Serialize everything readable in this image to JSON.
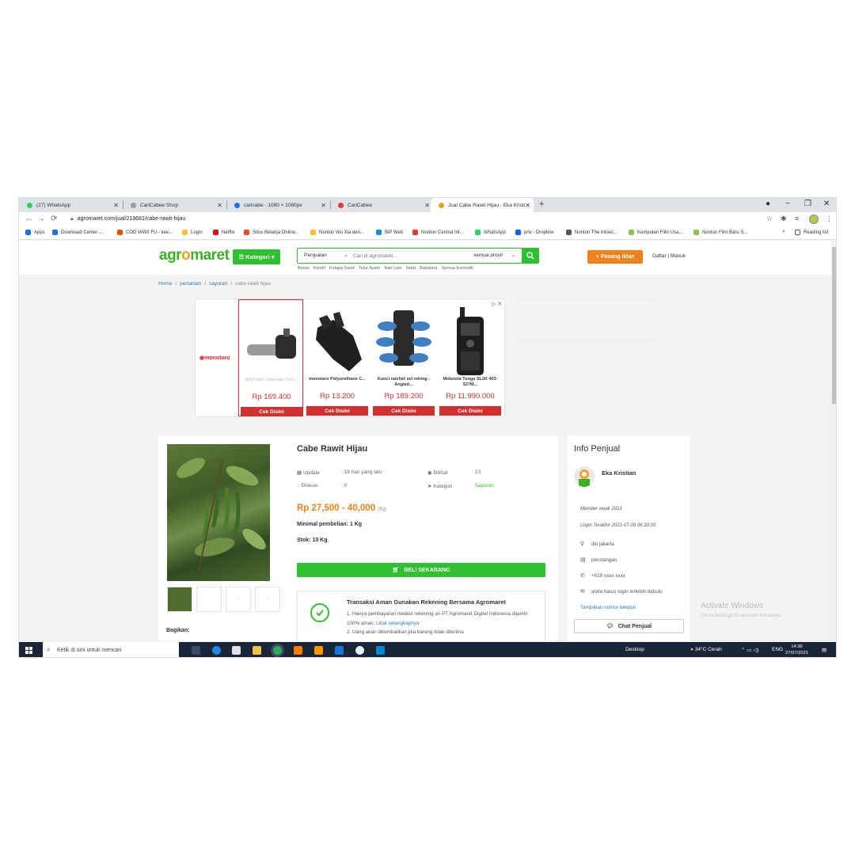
{
  "browser": {
    "tabs": [
      {
        "title": "(27) WhatsApp",
        "color": "#25d366"
      },
      {
        "title": "CariCabee Shop",
        "color": "#9e9e9e"
      },
      {
        "title": "caricabe - 1080 × 1080px",
        "color": "#1a73e8"
      },
      {
        "title": "CariCabee",
        "color": "#e53935"
      },
      {
        "title": "Jual Cabe Rawit Hijau - Eka Kristi",
        "color": "#e8a317"
      }
    ],
    "url": "agromaret.com/jual/219681/cabe-rawit-hijau",
    "bookmarks": [
      {
        "label": "Apps",
        "color": "#1a73e8"
      },
      {
        "label": "Download Center -...",
        "color": "#1a73e8"
      },
      {
        "label": "COD WWII FU - kee...",
        "color": "#e65100"
      },
      {
        "label": "Login",
        "color": "#fbc02d"
      },
      {
        "label": "Netflix",
        "color": "#e50914"
      },
      {
        "label": "Situs Belanja Online...",
        "color": "#ee4d2d"
      },
      {
        "label": "Nonton Wu Xia den...",
        "color": "#fbc02d"
      },
      {
        "label": "BiP Web",
        "color": "#1e88e5"
      },
      {
        "label": "Nonton Central Int...",
        "color": "#e53935"
      },
      {
        "label": "WhatsApp",
        "color": "#25d366"
      },
      {
        "label": "priv - Dropbox",
        "color": "#0061ff"
      },
      {
        "label": "Nonton The Intouc...",
        "color": "#555555"
      },
      {
        "label": "Kumpulan Film Usa...",
        "color": "#8bc34a"
      },
      {
        "label": "Nonton Film Baru S...",
        "color": "#8bc34a"
      }
    ],
    "bookmarks_more": "»",
    "reading_list": "Reading list"
  },
  "site": {
    "logo_left": "agr",
    "logo_o": "o",
    "logo_right": "maret",
    "kategori_label": "☰ Kategori ▾",
    "search_type": "Penjualan",
    "search_placeholder": "Cari di agromaret...",
    "province": "semua provir",
    "quicklinks": [
      "Beras",
      "Kemiri",
      "Kelapa Sawit",
      "Telur Ayam",
      "Ikan Lele",
      "Sidat",
      "Batubara",
      "Semua Komoditi"
    ],
    "pasang_label": "+ Pasang Iklan",
    "auth_label": "Daftar | Masuk"
  },
  "breadcrumb": [
    "Home",
    "pertanian",
    "sayuran",
    "cabe rawit hijau"
  ],
  "ads": {
    "brand": "monotaro",
    "cta": "Cek Disini",
    "items": [
      {
        "name": "MAXTank Chainsaw Genl...",
        "price": "Rp 169.400"
      },
      {
        "name": "monotaro Polyurethane C...",
        "price": "Rp 13.200"
      },
      {
        "name": "Kunci ratchet set miring - Angled...",
        "price": "Rp 189.200"
      },
      {
        "name": "Motorola Tonga SL2K 403-527M...",
        "price": "Rp 11.990.000"
      }
    ]
  },
  "product": {
    "title": "Cabe Rawit Hijau",
    "update_label": "Update",
    "update_value": ": 18 hari yang lalu",
    "dilihat_label": "Dilihat",
    "dilihat_value": ": 13",
    "diskusi_label": "Diskusi",
    "diskusi_value": ": 0",
    "kategori_label": "Kategori",
    "kategori_value": ": Sayuran",
    "price": "Rp 27,500 - 40,000",
    "unit": "/Kg",
    "min_purchase": "Minimal pembelian: 1 Kg",
    "stock": "Stok: 10 Kg",
    "buy_label": "BELI SEKARANG",
    "share_label": "Bagikan:",
    "safe_title": "Transaksi Aman Gunakan Rekening Bersama Agromaret",
    "safe_item1": "1. Hanya pembayaran melalui rekening an PT Agromaret Digital Indonesia dijamin 100% aman.",
    "safe_item1_link": "Lihat selengkapnya",
    "safe_item2": "2. Uang akan dikembalikan jika barang tidak diterima"
  },
  "seller": {
    "heading": "Info Penjual",
    "name": "Eka Kristian",
    "member_since": "Member sejak 2021",
    "last_login": "Login Terakhir 2021-07-09 06:30:05",
    "location": "dki jakarta",
    "type": "perorangan",
    "phone": "+628 xxxx xxxx",
    "email": "anda harus login terlebih dahulu",
    "show_phone": "Tampilkan nomor telepon",
    "chat_label": "Chat Penjual"
  },
  "watermark": {
    "line1": "Activate Windows",
    "line2": "Go to Settings to activate Windows."
  },
  "taskbar": {
    "search_placeholder": "Ketik di sini untuk mencari",
    "desktop": "Desktop",
    "weather": "34°C Cerah",
    "lang": "ENG",
    "time": "14:36",
    "date": "27/07/2021"
  }
}
